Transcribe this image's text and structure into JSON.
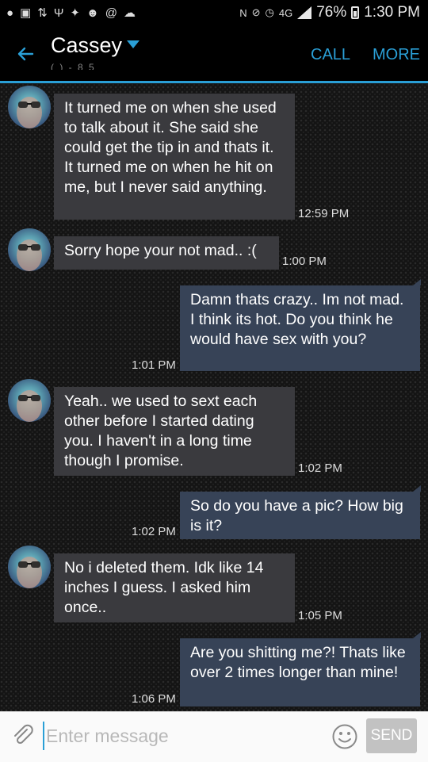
{
  "status_bar": {
    "time": "1:30 PM",
    "battery": "76%",
    "network": "4G",
    "network_sub": "LTE"
  },
  "header": {
    "contact_name": "Cassey",
    "subtitle": "(   )   -   8 5  ",
    "call_label": "CALL",
    "more_label": "MORE"
  },
  "messages": [
    {
      "direction": "in",
      "text": "It turned me on when she used to talk about it. She said she could get the tip in and thats it. It turned me on when he hit on me, but I never said anything.",
      "time": "12:59 PM"
    },
    {
      "direction": "in",
      "text": "Sorry hope your not mad.. :(",
      "time": "1:00 PM"
    },
    {
      "direction": "out",
      "text": "Damn thats crazy.. Im not mad. I think its hot. Do you think he would have sex with you?",
      "time": "1:01 PM"
    },
    {
      "direction": "in",
      "text": "Yeah.. we used to sext each other before I started dating you. I haven't in a long time though I promise.",
      "time": "1:02 PM"
    },
    {
      "direction": "out",
      "text": "So do you have a pic? How big is it?",
      "time": "1:02 PM"
    },
    {
      "direction": "in",
      "text": "No i deleted them. Idk like 14 inches I guess. I asked him once..",
      "time": "1:05 PM"
    },
    {
      "direction": "out",
      "text": "Are you shitting me?! Thats like over 2 times longer than mine!",
      "time": "1:06 PM"
    }
  ],
  "compose": {
    "placeholder": "Enter message",
    "value": "",
    "send_label": "SEND"
  },
  "colors": {
    "accent": "#2a9fd6",
    "incoming_bubble": "#3a3a3e",
    "outgoing_bubble": "#374357",
    "send_disabled": "#c2c2c2"
  }
}
